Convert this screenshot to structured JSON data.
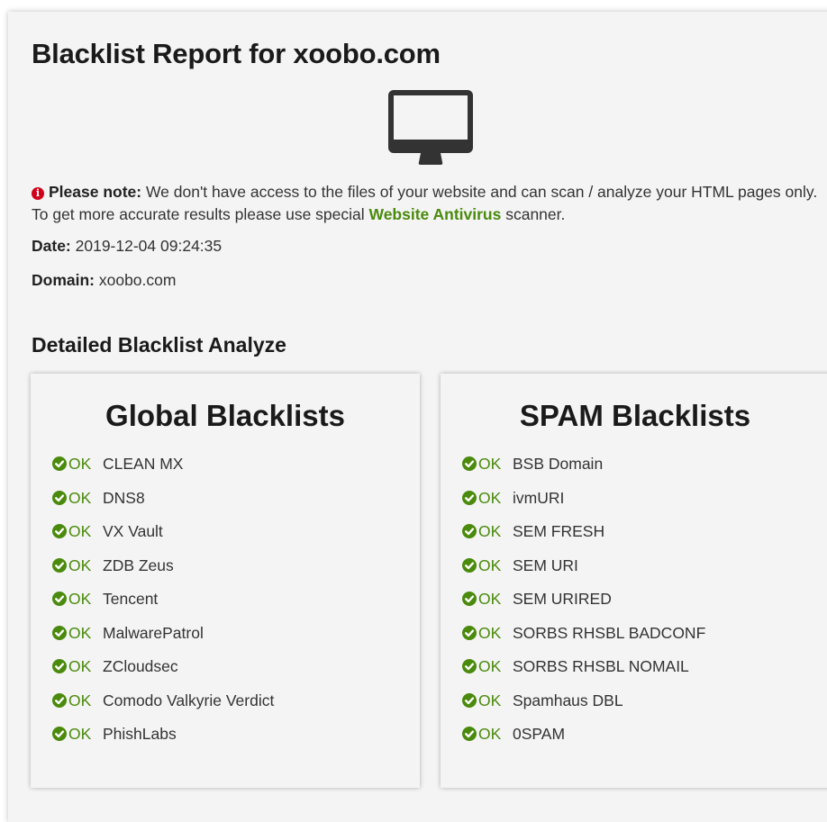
{
  "report": {
    "title": "Blacklist Report for xoobo.com",
    "device_icon": "desktop-monitor-icon"
  },
  "note": {
    "icon": "info-circle-icon",
    "label": "Please note:",
    "text_before": " We don't have access to the files of your website and can scan / analyze your HTML pages only. To get more accurate results please use special ",
    "link_text": "Website Antivirus",
    "text_after": " scanner.",
    "link_color": "#4a8a0c",
    "icon_color": "#d0021b"
  },
  "meta": {
    "date_label": "Date:",
    "date_value": " 2019-12-04 09:24:35",
    "domain_label": "Domain:",
    "domain_value": " xoobo.com"
  },
  "section": {
    "title": "Detailed Blacklist Analyze"
  },
  "status_color": "#4a8a0c",
  "global": {
    "title": "Global Blacklists",
    "items": [
      {
        "status": "OK",
        "name": "CLEAN MX"
      },
      {
        "status": "OK",
        "name": "DNS8"
      },
      {
        "status": "OK",
        "name": "VX Vault"
      },
      {
        "status": "OK",
        "name": "ZDB Zeus"
      },
      {
        "status": "OK",
        "name": "Tencent"
      },
      {
        "status": "OK",
        "name": "MalwarePatrol"
      },
      {
        "status": "OK",
        "name": "ZCloudsec"
      },
      {
        "status": "OK",
        "name": "Comodo Valkyrie Verdict"
      },
      {
        "status": "OK",
        "name": "PhishLabs"
      }
    ]
  },
  "spam": {
    "title": "SPAM Blacklists",
    "items": [
      {
        "status": "OK",
        "name": "BSB Domain"
      },
      {
        "status": "OK",
        "name": "ivmURI"
      },
      {
        "status": "OK",
        "name": "SEM FRESH"
      },
      {
        "status": "OK",
        "name": "SEM URI"
      },
      {
        "status": "OK",
        "name": "SEM URIRED"
      },
      {
        "status": "OK",
        "name": "SORBS RHSBL BADCONF"
      },
      {
        "status": "OK",
        "name": "SORBS RHSBL NOMAIL"
      },
      {
        "status": "OK",
        "name": "Spamhaus DBL"
      },
      {
        "status": "OK",
        "name": "0SPAM"
      }
    ]
  }
}
